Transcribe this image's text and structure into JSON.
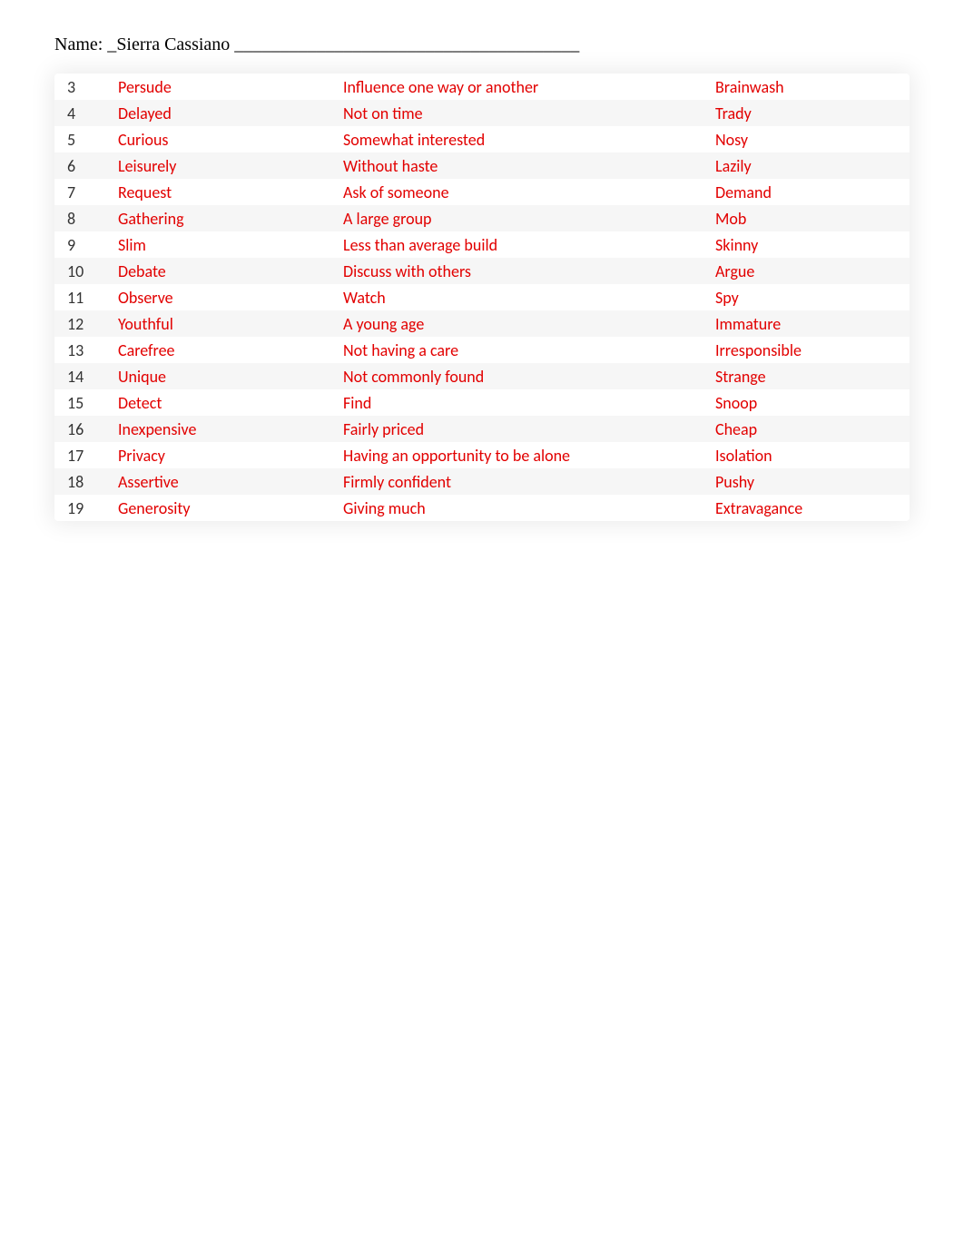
{
  "header": {
    "name_label": "Name:  _",
    "name_value": "Sierra Cassiano",
    "name_underline": " ______________________________________"
  },
  "rows": [
    {
      "num": "3",
      "word": "Persude",
      "def": "Influence one way or another",
      "syn": "Brainwash"
    },
    {
      "num": "4",
      "word": "Delayed",
      "def": "Not on time",
      "syn": "Trady"
    },
    {
      "num": "5",
      "word": "Curious",
      "def": "Somewhat interested",
      "syn": "Nosy"
    },
    {
      "num": "6",
      "word": "Leisurely",
      "def": "Without haste",
      "syn": "Lazily"
    },
    {
      "num": "7",
      "word": "Request",
      "def": "Ask of someone",
      "syn": "Demand"
    },
    {
      "num": "8",
      "word": "Gathering",
      "def": "A large group",
      "syn": "Mob"
    },
    {
      "num": "9",
      "word": "Slim",
      "def": "Less than average build",
      "syn": "Skinny"
    },
    {
      "num": "10",
      "word": "Debate",
      "def": "Discuss with others",
      "syn": "Argue"
    },
    {
      "num": "11",
      "word": "Observe",
      "def": "Watch",
      "syn": "Spy"
    },
    {
      "num": "12",
      "word": "Youthful",
      "def": "A young age",
      "syn": "Immature"
    },
    {
      "num": "13",
      "word": "Carefree",
      "def": "Not having a care",
      "syn": "Irresponsible"
    },
    {
      "num": "14",
      "word": "Unique",
      "def": "Not commonly found",
      "syn": "Strange"
    },
    {
      "num": "15",
      "word": "Detect",
      "def": "Find",
      "syn": "Snoop"
    },
    {
      "num": "16",
      "word": "Inexpensive",
      "def": "Fairly priced",
      "syn": "Cheap"
    },
    {
      "num": "17",
      "word": "Privacy",
      "def": "Having an opportunity to be alone",
      "syn": "Isolation"
    },
    {
      "num": "18",
      "word": "Assertive",
      "def": "Firmly confident",
      "syn": "Pushy"
    },
    {
      "num": "19",
      "word": "Generosity",
      "def": "Giving much",
      "syn": "Extravagance"
    }
  ]
}
